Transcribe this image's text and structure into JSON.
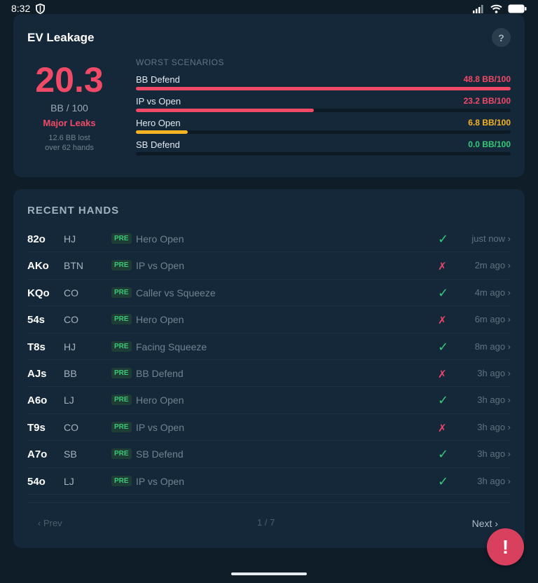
{
  "status_bar": {
    "time": "8:32"
  },
  "ev_card": {
    "title": "EV Leakage",
    "help_label": "?",
    "score": "20.3",
    "unit": "BB / 100",
    "status": "Major Leaks",
    "note_line1": "12.6 BB lost",
    "note_line2": "over 62 hands",
    "scenarios_header": "WORST SCENARIOS",
    "scenarios": [
      {
        "name": "BB Defend",
        "value": "48.8 BB/100",
        "fraction": 1.0,
        "color": "#f04a66"
      },
      {
        "name": "IP vs Open",
        "value": "23.2 BB/100",
        "fraction": 0.475,
        "color": "#f04a66"
      },
      {
        "name": "Hero Open",
        "value": "6.8 BB/100",
        "fraction": 0.139,
        "color": "#f5b323"
      },
      {
        "name": "SB Defend",
        "value": "0.0 BB/100",
        "fraction": 0.0,
        "color": "#35c97a"
      }
    ]
  },
  "hands_card": {
    "title": "RECENT HANDS",
    "hands": [
      {
        "cards": "82o",
        "pos": "HJ",
        "street": "PRE",
        "scenario": "Hero Open",
        "correct": true,
        "time": "just now ›"
      },
      {
        "cards": "AKo",
        "pos": "BTN",
        "street": "PRE",
        "scenario": "IP vs Open",
        "correct": false,
        "time": "2m ago ›"
      },
      {
        "cards": "KQo",
        "pos": "CO",
        "street": "PRE",
        "scenario": "Caller vs Squeeze",
        "correct": true,
        "time": "4m ago ›"
      },
      {
        "cards": "54s",
        "pos": "CO",
        "street": "PRE",
        "scenario": "Hero Open",
        "correct": false,
        "time": "6m ago ›"
      },
      {
        "cards": "T8s",
        "pos": "HJ",
        "street": "PRE",
        "scenario": "Facing Squeeze",
        "correct": true,
        "time": "8m ago ›"
      },
      {
        "cards": "AJs",
        "pos": "BB",
        "street": "PRE",
        "scenario": "BB Defend",
        "correct": false,
        "time": "3h ago ›"
      },
      {
        "cards": "A6o",
        "pos": "LJ",
        "street": "PRE",
        "scenario": "Hero Open",
        "correct": true,
        "time": "3h ago ›"
      },
      {
        "cards": "T9s",
        "pos": "CO",
        "street": "PRE",
        "scenario": "IP vs Open",
        "correct": false,
        "time": "3h ago ›"
      },
      {
        "cards": "A7o",
        "pos": "SB",
        "street": "PRE",
        "scenario": "SB Defend",
        "correct": true,
        "time": "3h ago ›"
      },
      {
        "cards": "54o",
        "pos": "LJ",
        "street": "PRE",
        "scenario": "IP vs Open",
        "correct": true,
        "time": "3h ago ›"
      }
    ],
    "pager": {
      "prev": "‹ Prev",
      "page": "1 / 7",
      "next": "Next ›"
    }
  },
  "fab": {
    "label": "!"
  },
  "symbols": {
    "correct": "✓",
    "wrong": "✗"
  }
}
